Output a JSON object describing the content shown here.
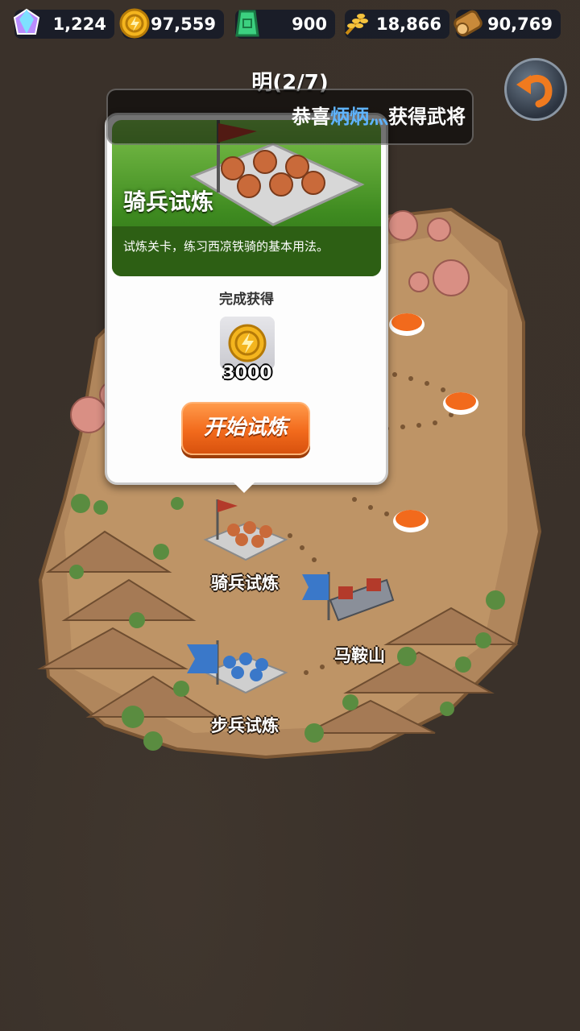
{
  "resources": [
    {
      "name": "gem",
      "icon": "gem-icon",
      "value": "1,224"
    },
    {
      "name": "coin",
      "icon": "coin-icon",
      "value": "97,559"
    },
    {
      "name": "jade",
      "icon": "jade-token-icon",
      "value": "900"
    },
    {
      "name": "grain",
      "icon": "wheat-icon",
      "value": "18,866"
    },
    {
      "name": "wood",
      "icon": "wood-log-icon",
      "value": "90,769"
    }
  ],
  "chapter_title": "明(2/7)",
  "ticker": {
    "prefix": "恭喜",
    "player": "炳炳灬",
    "suffix": "获得武将"
  },
  "stage_popup": {
    "title": "骑兵试炼",
    "description": "试炼关卡，练习西凉铁骑的基本用法。",
    "reward_label": "完成获得",
    "reward_icon": "coin-icon",
    "reward_amount": "3000",
    "start_button": "开始试炼"
  },
  "map_nodes": [
    {
      "label": "骑兵试炼",
      "type": "cavalry-camp"
    },
    {
      "label": "马鞍山",
      "type": "fortress"
    },
    {
      "label": "步兵试炼",
      "type": "infantry-camp"
    }
  ],
  "colors": {
    "accent": "#f26a1c",
    "highlight_name": "#5fb4ff",
    "banner_green": "#3e8a20"
  }
}
